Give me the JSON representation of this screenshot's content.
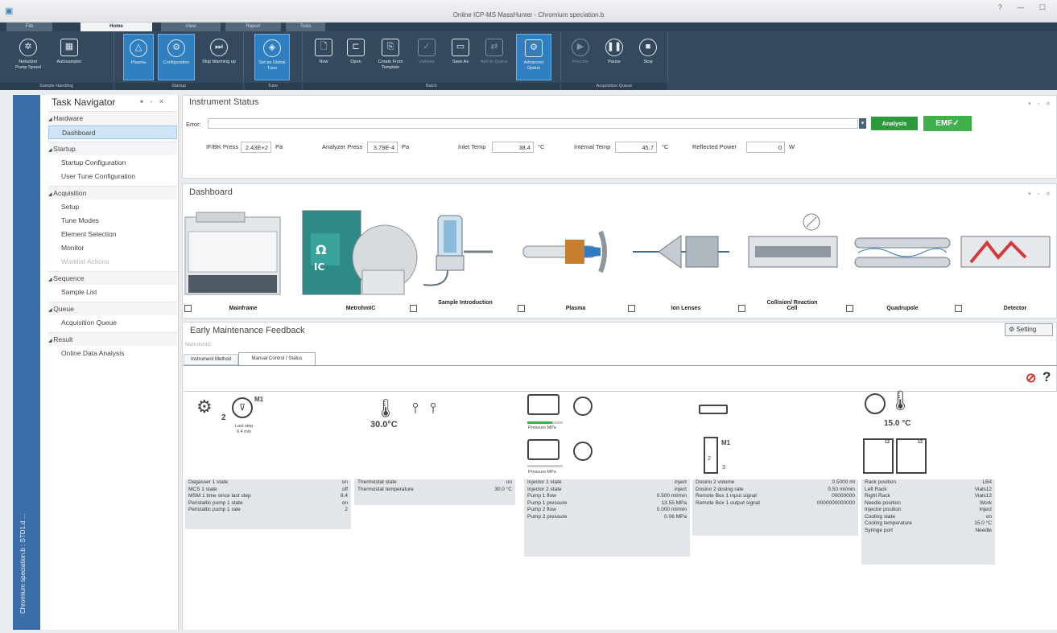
{
  "window": {
    "title": "Online ICP-MS MassHunter - Chromium speciation.b",
    "controls": "? — ☐"
  },
  "tabs": [
    "File",
    "Home",
    "View",
    "Report",
    "Tools"
  ],
  "ribbon": {
    "groups": [
      {
        "name": "Sample Handling",
        "buttons": [
          {
            "label": "Nebulizer Pump Speed",
            "icon": "nebulizer-icon",
            "state": "normal"
          },
          {
            "label": "Autosampler",
            "icon": "autosampler-icon",
            "state": "normal"
          }
        ]
      },
      {
        "name": "Startup",
        "buttons": [
          {
            "label": "Plasma",
            "icon": "plasma-icon",
            "state": "selected"
          },
          {
            "label": "Configuration",
            "icon": "gear-icon",
            "state": "selected"
          },
          {
            "label": "Skip Warming up",
            "icon": "skip-icon",
            "state": "normal"
          }
        ]
      },
      {
        "name": "Tune",
        "buttons": [
          {
            "label": "Set as Global Tune",
            "icon": "tune-icon",
            "state": "selected"
          }
        ]
      },
      {
        "name": "Batch",
        "buttons": [
          {
            "label": "New",
            "icon": "new-icon",
            "state": "normal"
          },
          {
            "label": "Open",
            "icon": "folder-icon",
            "state": "normal"
          },
          {
            "label": "Create From Template",
            "icon": "template-icon",
            "state": "normal"
          },
          {
            "label": "Validate",
            "icon": "validate-icon",
            "state": "disabled"
          },
          {
            "label": "Save As",
            "icon": "save-icon",
            "state": "normal"
          },
          {
            "label": "Add to Queue",
            "icon": "queue-icon",
            "state": "disabled"
          },
          {
            "label": "Advanced Option",
            "icon": "advanced-gear-icon",
            "state": "selected"
          }
        ]
      },
      {
        "name": "Acquisition Queue",
        "buttons": [
          {
            "label": "Resume",
            "icon": "play-icon",
            "state": "disabled"
          },
          {
            "label": "Pause",
            "icon": "pause-icon",
            "state": "normal"
          },
          {
            "label": "Stop",
            "icon": "stop-icon",
            "state": "normal"
          }
        ]
      }
    ]
  },
  "leftstrip": {
    "text": "Chromium speciation.b : STD1.d ..."
  },
  "navigator": {
    "title": "Task Navigator",
    "pin": "▾ ▫ ✕",
    "items": [
      {
        "label": "Hardware",
        "kind": "cat"
      },
      {
        "label": "Dashboard",
        "kind": "sub",
        "selected": true
      },
      {
        "label": "Startup",
        "kind": "cat"
      },
      {
        "label": "Startup Configuration",
        "kind": "sub"
      },
      {
        "label": "User Tune Configuration",
        "kind": "sub"
      },
      {
        "label": "Acquisition",
        "kind": "cat"
      },
      {
        "label": "Setup",
        "kind": "sub"
      },
      {
        "label": "Tune Modes",
        "kind": "sub"
      },
      {
        "label": "Element Selection",
        "kind": "sub"
      },
      {
        "label": "Monitor",
        "kind": "sub"
      },
      {
        "label": "Worklist Actions",
        "kind": "sub",
        "dim": true
      },
      {
        "label": "Sequence",
        "kind": "cat"
      },
      {
        "label": "Sample List",
        "kind": "sub"
      },
      {
        "label": "Queue",
        "kind": "cat"
      },
      {
        "label": "Acquisition Queue",
        "kind": "sub"
      },
      {
        "label": "Result",
        "kind": "cat"
      },
      {
        "label": "Online Data Analysis",
        "kind": "sub"
      }
    ]
  },
  "status": {
    "title": "Instrument Status",
    "error_label": "Error:",
    "analysis_button": "Analysis",
    "emf_button": "EMF✓",
    "fields": [
      {
        "label": "IF/BK Press",
        "value": "2.43E+2",
        "unit": "Pa"
      },
      {
        "label": "Analyzer Press",
        "value": "3.79E-4",
        "unit": "Pa"
      },
      {
        "label": "Inlet Temp",
        "value": "38.4",
        "unit": "°C"
      },
      {
        "label": "Internal Temp",
        "value": "45.7",
        "unit": "°C"
      },
      {
        "label": "Reflected Power",
        "value": "0",
        "unit": "W"
      }
    ],
    "colors": {
      "analysis": "#2e9a3b",
      "emf": "#3fb04a"
    }
  },
  "dashboard": {
    "title": "Dashboard",
    "components": [
      "Mainframe",
      "MetrohmIC",
      "Sample Introduction",
      "Plasma",
      "Ion Lenses",
      "Collision/ Reaction Cell",
      "Quadrupole",
      "Detector"
    ]
  },
  "maintenance": {
    "title": "Early Maintenance Feedback",
    "setting_button": "Setting",
    "subtitle": "MetrohmIC",
    "tabs": [
      "Instrument Method",
      "Manual Control / Status"
    ],
    "modules": {
      "m1_label": "M1",
      "m1_num": "2",
      "last_step": "Last step",
      "last_step_val": "6.4 min",
      "thermostat_temp": "30.0°C",
      "pressure_label_1": "Pressure MPa",
      "pressure_label_2": "Pressure MPa",
      "dosino_label": "M1",
      "dosino_num_top": "2",
      "dosino_num_bottom": "3",
      "cooler_temp": "15.0 °C",
      "rack_num": "12"
    },
    "tables": [
      [
        {
          "k": "Degasser 1 state",
          "v": "on"
        },
        {
          "k": "MCS 1 state",
          "v": "off"
        },
        {
          "k": "MSM 1 time since last step",
          "v": "8.4"
        },
        {
          "k": "Peristaltic pump 1 state",
          "v": "on"
        },
        {
          "k": "Peristaltic pump 1 rate",
          "v": "2"
        }
      ],
      [
        {
          "k": "Thermostat state",
          "v": "on"
        },
        {
          "k": "Thermostat temperature",
          "v": "30.0 °C"
        }
      ],
      [
        {
          "k": "Injector 1 state",
          "v": "inject"
        },
        {
          "k": "Injector 2 state",
          "v": "inject"
        },
        {
          "k": "Pump 1 flow",
          "v": "0.500 ml/min"
        },
        {
          "k": "Pump 1 pressure",
          "v": "13.55 MPa"
        },
        {
          "k": "Pump 2 flow",
          "v": "0.000 ml/min"
        },
        {
          "k": "Pump 2 pressure",
          "v": "0.06 MPa"
        }
      ],
      [
        {
          "k": "Dosino 2 volume",
          "v": "0.5000 ml"
        },
        {
          "k": "Dosino 2 dosing rate",
          "v": "0.50 ml/min"
        },
        {
          "k": "Remote Box 1 input signal",
          "v": "00000000"
        },
        {
          "k": "Remote Box 1 output signal",
          "v": "0000000000000"
        }
      ],
      [
        {
          "k": "Rack position",
          "v": "LB4"
        },
        {
          "k": "Left Rack",
          "v": "Vials12"
        },
        {
          "k": "Right Rack",
          "v": "Vials12"
        },
        {
          "k": "Needle position",
          "v": "Work"
        },
        {
          "k": "Injector position",
          "v": "Inject"
        },
        {
          "k": "Cooling state",
          "v": "on"
        },
        {
          "k": "Cooling temperature",
          "v": "15.0 °C"
        },
        {
          "k": "Syringe port",
          "v": "Needle"
        }
      ]
    ]
  }
}
